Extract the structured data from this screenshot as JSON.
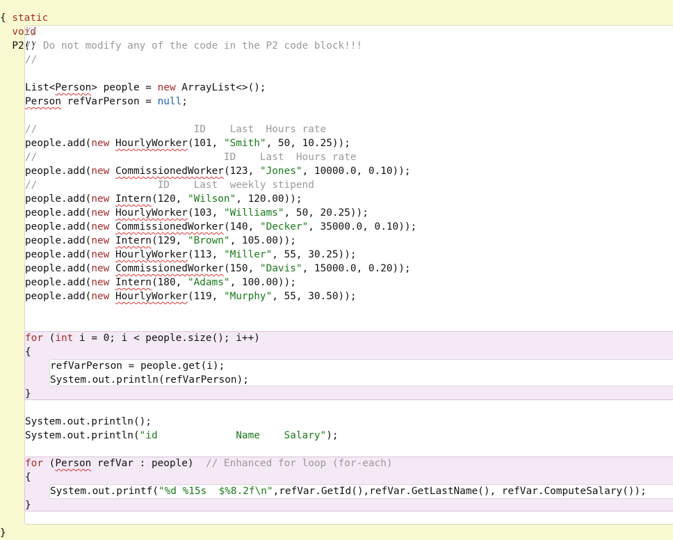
{
  "header": {
    "signature": "static void P2()",
    "open_brace": "{",
    "close_brace": "}"
  },
  "comments": {
    "c1": "//",
    "c2": "// Do not modify any of the code in the P2 code block!!!",
    "c3": "//",
    "hourly": "//                          ID    Last  Hours rate",
    "commissioned": "//                               ID    Last  Hours rate",
    "intern": "//                    ID    Last  weekly stipend"
  },
  "decls": {
    "list_type": "List<",
    "list_generic": "Person",
    "list_rest": "> people = ",
    "new_kw": "new",
    "list_ctor": " ArrayList<>();",
    "person_type": "Person",
    "ref_decl": " refVarPerson = ",
    "null_kw": "null",
    "semicolon": ";"
  },
  "adds": [
    {
      "prefix": "people.add(",
      "kw": "new",
      "cls": "HourlyWorker",
      "args": [
        {
          "t": "n",
          "v": "(101, "
        },
        {
          "t": "s",
          "v": "\"Smith\""
        },
        {
          "t": "n",
          "v": ", 50, 10.25));"
        }
      ]
    },
    {
      "prefix": "people.add(",
      "kw": "new",
      "cls": "CommissionedWorker",
      "args": [
        {
          "t": "n",
          "v": "(123, "
        },
        {
          "t": "s",
          "v": "\"Jones\""
        },
        {
          "t": "n",
          "v": ", 10000.0, 0.10));"
        }
      ]
    },
    {
      "prefix": "people.add(",
      "kw": "new",
      "cls": "Intern",
      "args": [
        {
          "t": "n",
          "v": "(120, "
        },
        {
          "t": "s",
          "v": "\"Wilson\""
        },
        {
          "t": "n",
          "v": ", 120.00));"
        }
      ]
    },
    {
      "prefix": "people.add(",
      "kw": "new",
      "cls": "HourlyWorker",
      "args": [
        {
          "t": "n",
          "v": "(103, "
        },
        {
          "t": "s",
          "v": "\"Williams\""
        },
        {
          "t": "n",
          "v": ", 50, 20.25));"
        }
      ]
    },
    {
      "prefix": "people.add(",
      "kw": "new",
      "cls": "CommissionedWorker",
      "args": [
        {
          "t": "n",
          "v": "(140, "
        },
        {
          "t": "s",
          "v": "\"Decker\""
        },
        {
          "t": "n",
          "v": ", 35000.0, 0.10));"
        }
      ]
    },
    {
      "prefix": "people.add(",
      "kw": "new",
      "cls": "Intern",
      "args": [
        {
          "t": "n",
          "v": "(129, "
        },
        {
          "t": "s",
          "v": "\"Brown\""
        },
        {
          "t": "n",
          "v": ", 105.00));"
        }
      ]
    },
    {
      "prefix": "people.add(",
      "kw": "new",
      "cls": "HourlyWorker",
      "args": [
        {
          "t": "n",
          "v": "(113, "
        },
        {
          "t": "s",
          "v": "\"Miller\""
        },
        {
          "t": "n",
          "v": ", 55, 30.25));"
        }
      ]
    },
    {
      "prefix": "people.add(",
      "kw": "new",
      "cls": "CommissionedWorker",
      "args": [
        {
          "t": "n",
          "v": "(150, "
        },
        {
          "t": "s",
          "v": "\"Davis\""
        },
        {
          "t": "n",
          "v": ", 15000.0, 0.20));"
        }
      ]
    },
    {
      "prefix": "people.add(",
      "kw": "new",
      "cls": "Intern",
      "args": [
        {
          "t": "n",
          "v": "(180, "
        },
        {
          "t": "s",
          "v": "\"Adams\""
        },
        {
          "t": "n",
          "v": ", 100.00));"
        }
      ]
    },
    {
      "prefix": "people.add(",
      "kw": "new",
      "cls": "HourlyWorker",
      "args": [
        {
          "t": "n",
          "v": "(119, "
        },
        {
          "t": "s",
          "v": "\"Murphy\""
        },
        {
          "t": "n",
          "v": ", 55, 30.50));"
        }
      ]
    }
  ],
  "loop1": {
    "for_kw": "for",
    "open": " (",
    "int_kw": "int",
    "cond": " i = 0; i < people.size(); i++)",
    "open_brace": "{",
    "body1": "refVarPerson = people.get(i);",
    "body2": "System.out.println(refVarPerson);",
    "close_brace": "}"
  },
  "prints": {
    "println_empty": "System.out.println();",
    "println_prefix": "System.out.println(",
    "header_str": "\"id             Name    Salary\"",
    "println_suffix": ");"
  },
  "loop2": {
    "for_kw": "for",
    "open": " (",
    "person_type": "Person",
    "rest": " refVar : people)  ",
    "comment": "// Enhanced for loop (for-each)",
    "open_brace": "{",
    "printf_prefix": "System.out.printf(",
    "format_str": "\"%d %15s  $%8.2f\\n\"",
    "printf_rest": ",refVar.GetId(),refVar.GetLastName(), refVar.ComputeSalary());",
    "close_brace": "}"
  },
  "colors": {
    "background": "#fafad2",
    "block_bg": "#ffffff",
    "loop_bg": "#f5e9f5",
    "keyword": "#a52a2a",
    "literal": "#1f5fa6",
    "string": "#1a7a1a",
    "comment": "#9a9a9a",
    "squiggle": "#e03030"
  }
}
